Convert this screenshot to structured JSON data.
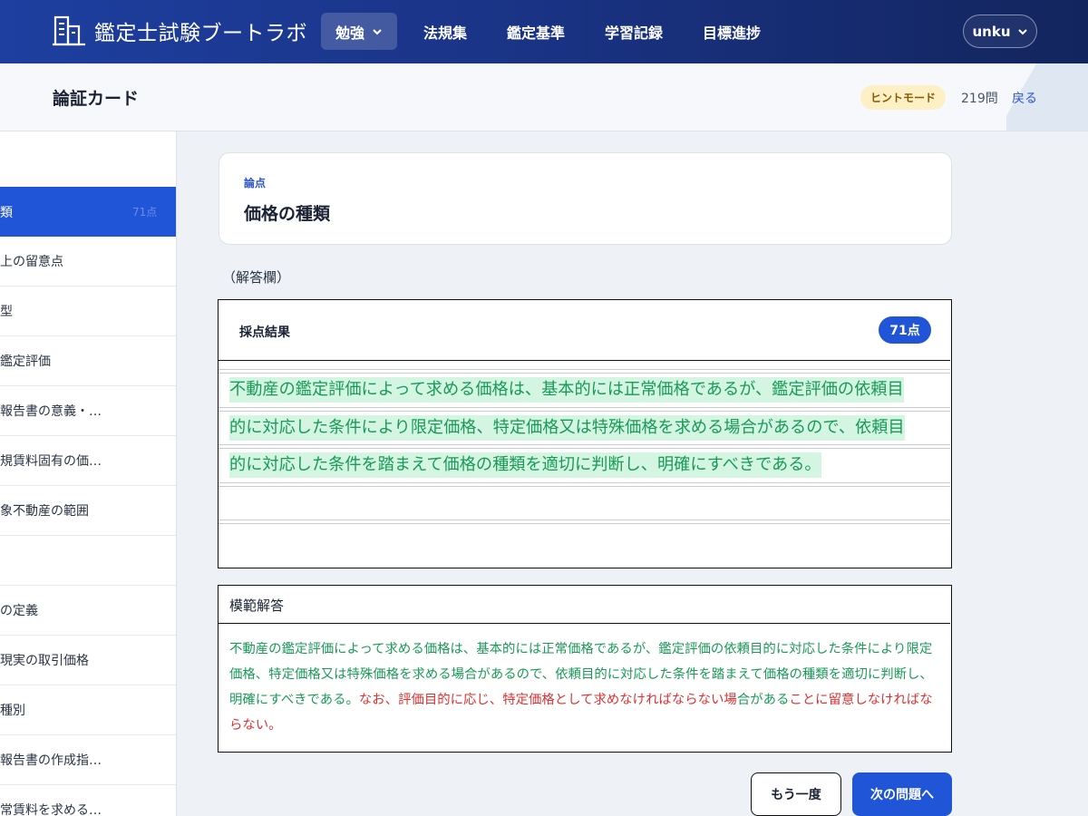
{
  "app": {
    "brand": "鑑定士試験ブートラボ",
    "nav": [
      "勉強",
      "法規集",
      "鑑定基準",
      "学習記録",
      "目標進捗"
    ],
    "user": "unku"
  },
  "subheader": {
    "title": "論証カード",
    "hint_mode": "ヒントモード",
    "count": "219問",
    "back": "戻る"
  },
  "sidebar": {
    "items": [
      {
        "label": "類",
        "score": "71点",
        "active": true
      },
      {
        "label": "上の留意点"
      },
      {
        "label": "型"
      },
      {
        "label": "鑑定評価"
      },
      {
        "label": "報告書の意義・…"
      },
      {
        "label": "規賃料固有の価…"
      },
      {
        "label": "象不動産の範囲"
      },
      {
        "label": ""
      },
      {
        "label": "の定義"
      },
      {
        "label": "現実の取引価格"
      },
      {
        "label": "種別"
      },
      {
        "label": "報告書の作成指…"
      },
      {
        "label": "常賃料を求める…"
      }
    ]
  },
  "topic": {
    "label": "論点",
    "title": "価格の種類"
  },
  "answer": {
    "heading": "（解答欄）",
    "result_title": "採点結果",
    "score": "71点",
    "lines": [
      "不動産の鑑定評価によって求める価格は、基本的には正常価格であるが、鑑定評価の依頼目",
      "的に対応した条件により限定価格、特定価格又は特殊価格を求める場合があるので、依頼目",
      "的に対応した条件を踏まえて価格の種類を適切に判断し、明確にすべきである。",
      "",
      ""
    ]
  },
  "model": {
    "title": "模範解答",
    "matched": "不動産の鑑定評価によって求める価格は、基本的には正常価格であるが、鑑定評価の依頼目的に対応した条件により限定価格、特定価格又は特殊価格を求める場合があるので、依頼目的に対応した条件を踏まえて価格の種類を適切に判断し、明確にすべきである。",
    "missed_a": "なお、評価目的に応じ、特定価格として求めなければならない場",
    "mixed_b": "合がある",
    "missed_c": "ことに留意しなければならない。"
  },
  "buttons": {
    "retry": "もう一度",
    "next": "次の問題へ"
  },
  "colors": {
    "brand": "#1e3fa0",
    "accent": "#1f55d6",
    "match": "#1a9a57",
    "miss": "#e03030"
  }
}
